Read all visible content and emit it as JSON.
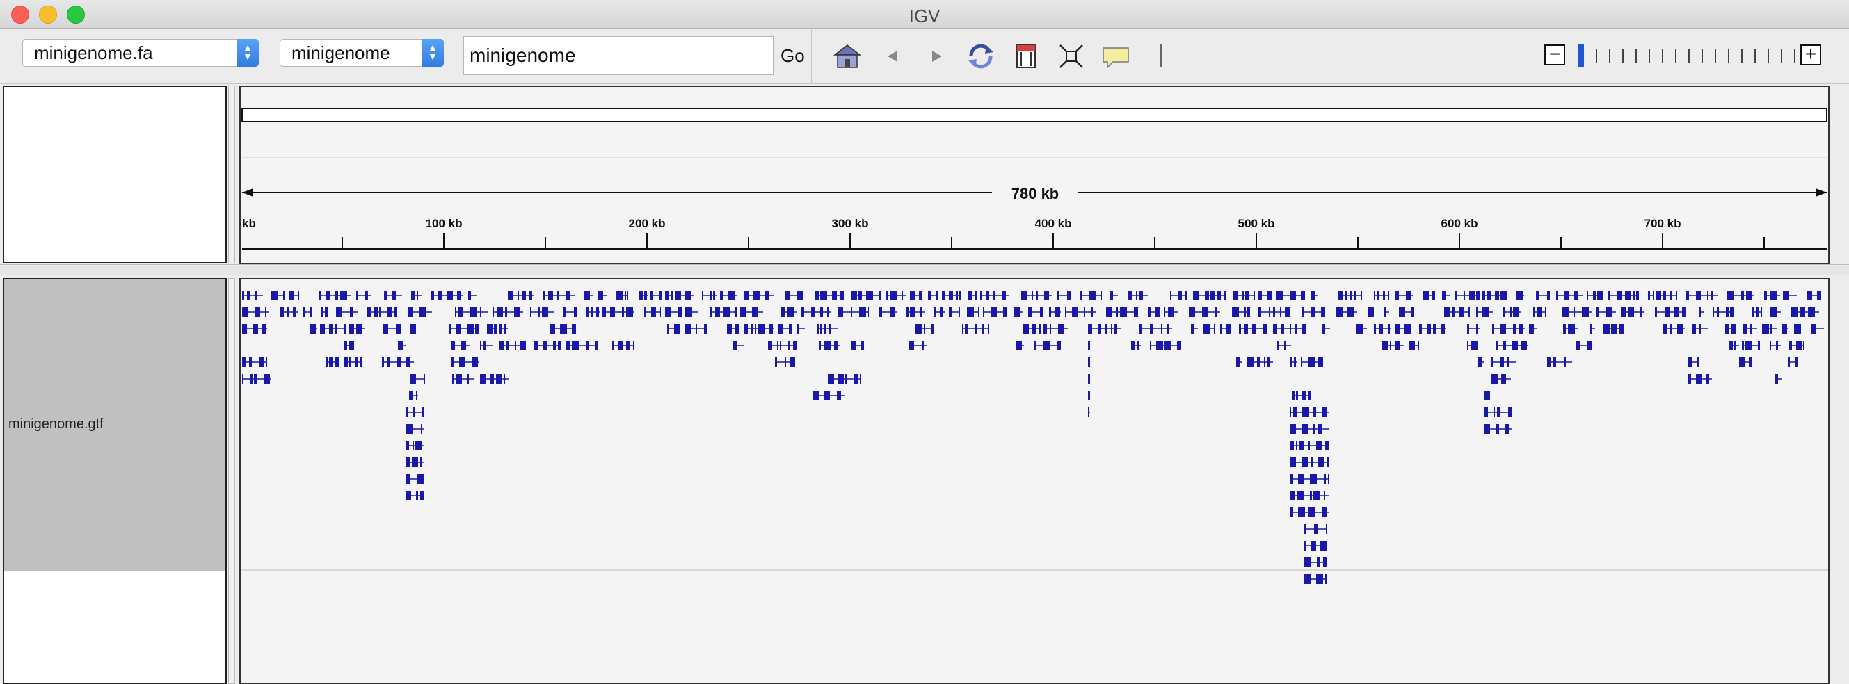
{
  "window": {
    "title": "IGV"
  },
  "toolbar": {
    "genome_select": "minigenome.fa",
    "chromosome_select": "minigenome",
    "locus_value": "minigenome",
    "go_label": "Go",
    "icons": [
      "home-icon",
      "back-icon",
      "forward-icon",
      "refresh-icon",
      "region-icon",
      "resize-icon",
      "popup-text-icon",
      "ruler-line-icon"
    ]
  },
  "ruler": {
    "span_label": "780 kb",
    "ticks": [
      "kb",
      "100 kb",
      "200 kb",
      "300 kb",
      "400 kb",
      "500 kb",
      "600 kb",
      "700 kb"
    ]
  },
  "tracks": [
    {
      "name": "minigenome.gtf",
      "feature_color": "#1a18a8"
    }
  ],
  "colors": {
    "feature": "#1a18a8",
    "zoom_thumb": "#2255d0"
  }
}
